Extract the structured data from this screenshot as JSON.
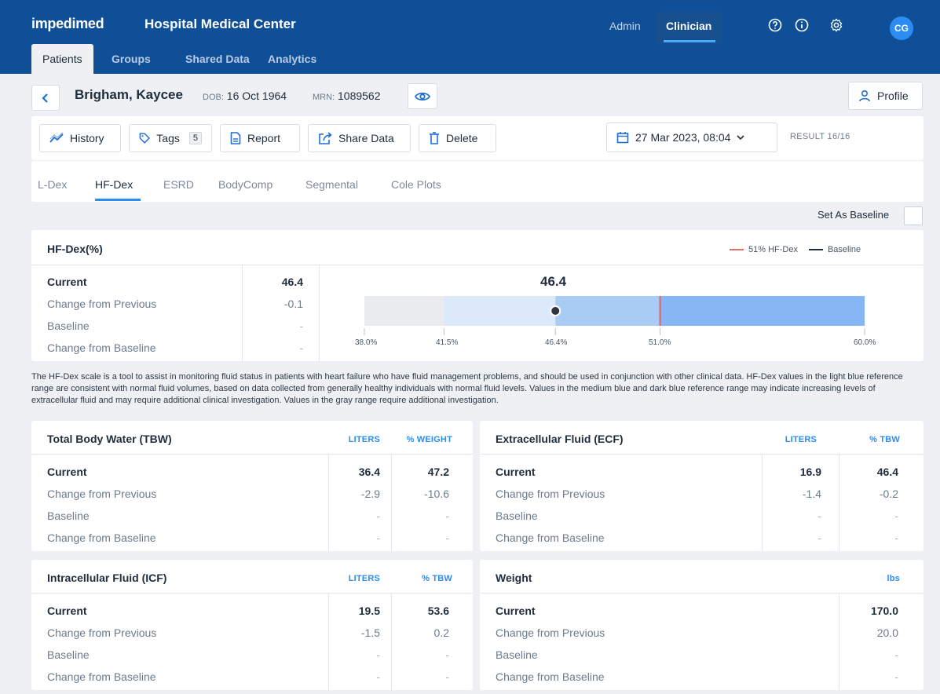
{
  "app": {
    "logo": "impedimed",
    "org_name": "Hospital Medical Center",
    "roles": [
      "Admin",
      "Clinician"
    ],
    "avatar_initials": "CG"
  },
  "nav": {
    "tabs": [
      "Patients",
      "Groups",
      "Shared Data",
      "Analytics"
    ]
  },
  "patient": {
    "name": "Brigham, Kaycee",
    "dob_label": "DOB:",
    "dob": "16 Oct 1964",
    "mrn_label": "MRN:",
    "mrn": "1089562",
    "profile_label": "Profile"
  },
  "toolbar": {
    "history": "History",
    "tags": "Tags",
    "tags_count": "5",
    "report": "Report",
    "share": "Share Data",
    "delete": "Delete",
    "date": "27 Mar 2023, 08:04",
    "result": "RESULT 16/16"
  },
  "subtabs": [
    "L-Dex",
    "HF-Dex",
    "ESRD",
    "BodyComp",
    "Segmental",
    "Cole Plots"
  ],
  "baseline": {
    "label": "Set As Baseline"
  },
  "rows": [
    "Current",
    "Change from Previous",
    "Baseline",
    "Change from Baseline"
  ],
  "hfdex": {
    "title": "HF-Dex(%)",
    "legend_threshold": "51% HF-Dex",
    "legend_baseline": "Baseline",
    "values": [
      "46.4",
      "-0.1",
      "-",
      "-"
    ],
    "current": "46.4",
    "scale_min": 38.0,
    "scale_max": 60.0,
    "gray_end": 41.5,
    "threshold": 51.0,
    "ticks": [
      "38.0%",
      "41.5%",
      "46.4%",
      "51.0%",
      "60.0%"
    ],
    "colors": {
      "gray": "#e9ebee",
      "light_blue": "#dbe9fb",
      "medium_blue": "#a9ccf5",
      "dark_blue": "#86b6f3",
      "threshold": "#e86a6a",
      "marker": "#2e3440"
    }
  },
  "note": "The HF-Dex scale is a tool to assist in monitoring fluid status in patients with heart failure who have fluid management problems, and should be used in conjunction with other clinical data. HF-Dex values in the light blue reference range are consistent with normal fluid volumes, based on data collected from generally healthy individuals with normal fluid levels. Values in the medium blue and dark blue reference range may indicate increasing levels of extracellular fluid and may require additional clinical investigation. Values in the gray range require additional investigation.",
  "tbw": {
    "title": "Total Body Water (TBW)",
    "col1": "LITERS",
    "col2": "% WEIGHT",
    "c1": [
      "36.4",
      "-2.9",
      "-",
      "-"
    ],
    "c2": [
      "47.2",
      "-10.6",
      "-",
      "-"
    ]
  },
  "ecf": {
    "title": "Extracellular Fluid (ECF)",
    "col1": "LITERS",
    "col2": "% TBW",
    "c1": [
      "16.9",
      "-1.4",
      "-",
      "-"
    ],
    "c2": [
      "46.4",
      "-0.2",
      "-",
      "-"
    ]
  },
  "icf": {
    "title": "Intracellular Fluid (ICF)",
    "col1": "LITERS",
    "col2": "% TBW",
    "c1": [
      "19.5",
      "-1.5",
      "-",
      "-"
    ],
    "c2": [
      "53.6",
      "0.2",
      "-",
      "-"
    ]
  },
  "weight": {
    "title": "Weight",
    "col1": "lbs",
    "c1": [
      "170.0",
      "20.0",
      "-",
      "-"
    ]
  }
}
